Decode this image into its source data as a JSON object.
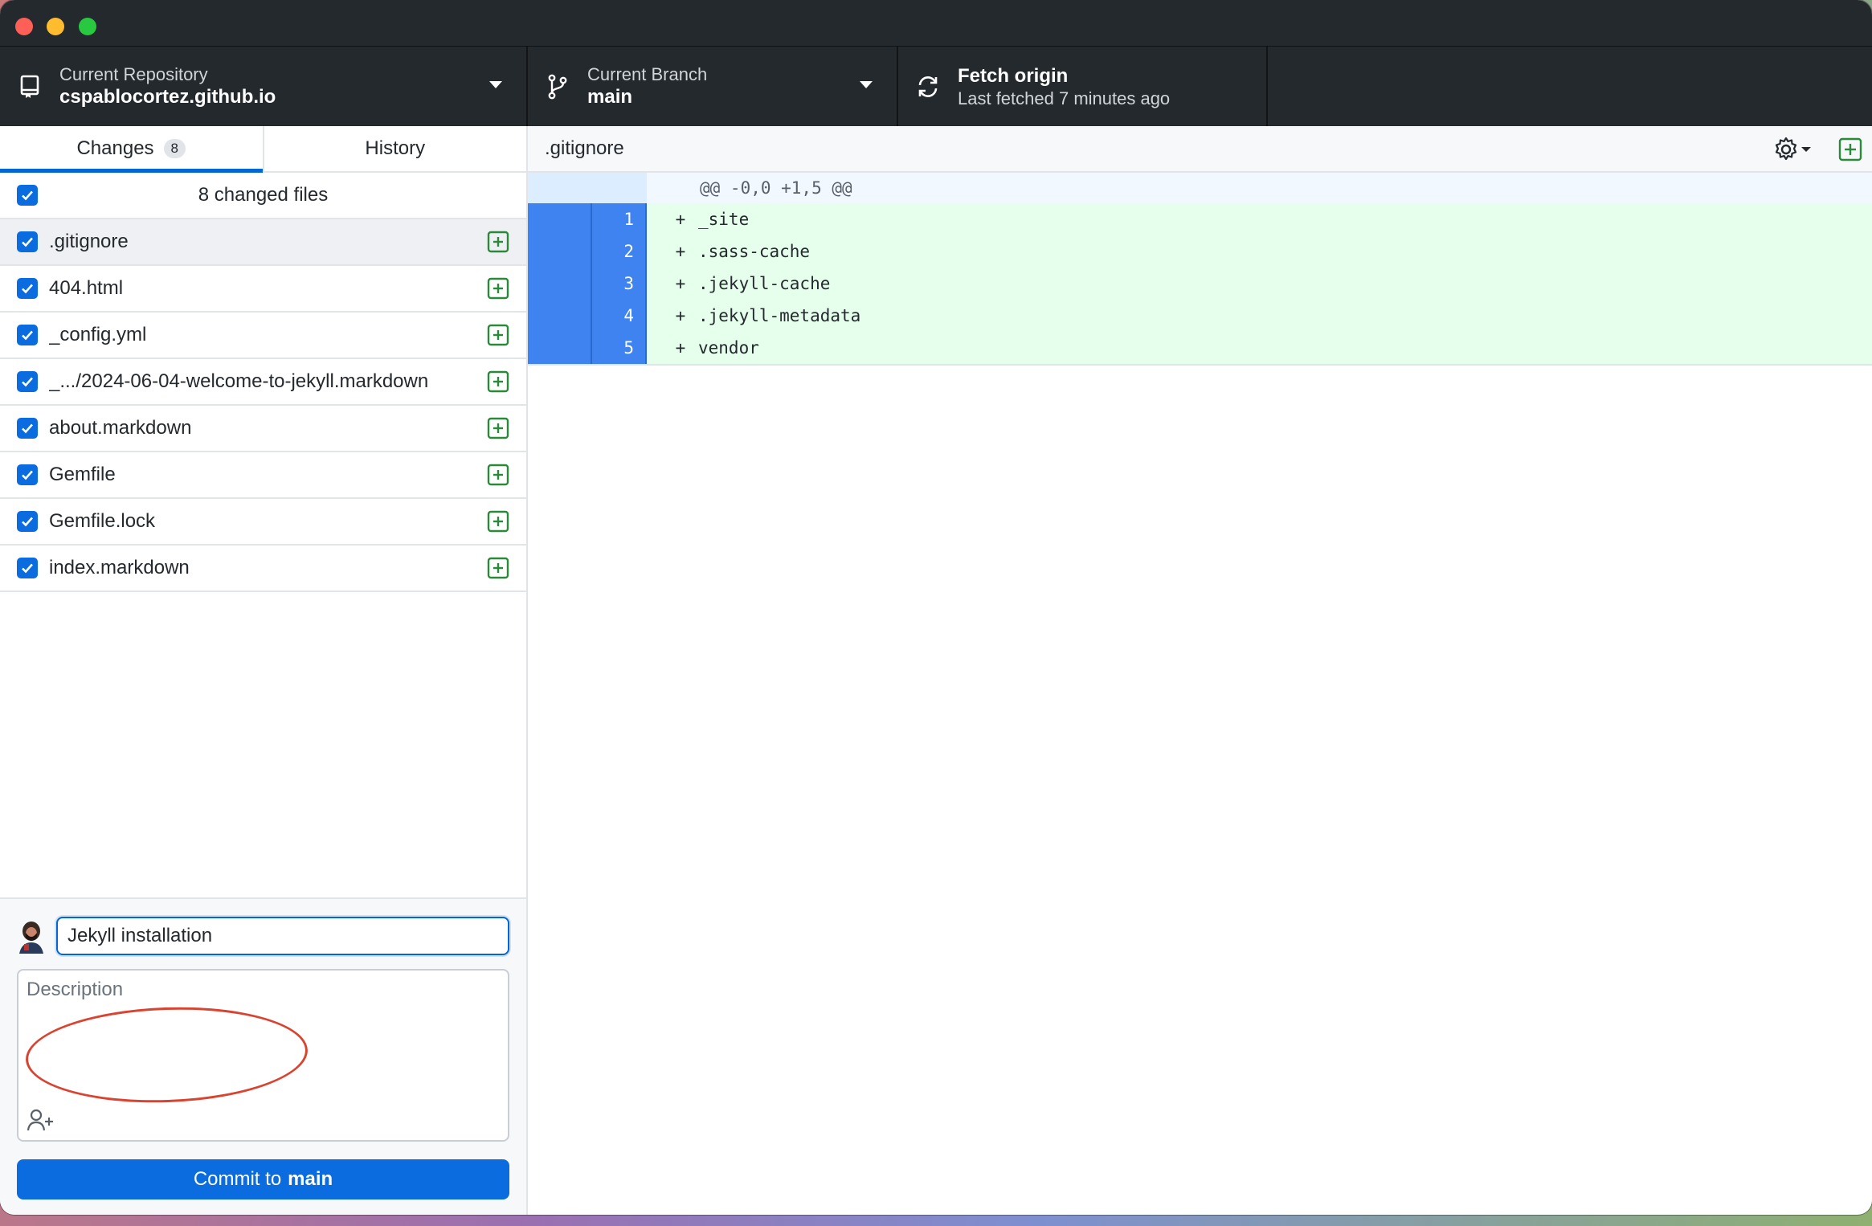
{
  "toolbar": {
    "repo": {
      "label": "Current Repository",
      "value": "cspablocortez.github.io"
    },
    "branch": {
      "label": "Current Branch",
      "value": "main"
    },
    "fetch": {
      "label": "Fetch origin",
      "value": "Last fetched 7 minutes ago"
    }
  },
  "tabs": [
    {
      "label": "Changes",
      "count": "8"
    },
    {
      "label": "History"
    }
  ],
  "files_header": "8 changed files",
  "files": [
    ".gitignore",
    "404.html",
    "_config.yml",
    "_.../2024-06-04-welcome-to-jekyll.markdown",
    "about.markdown",
    "Gemfile",
    "Gemfile.lock",
    "index.markdown"
  ],
  "commit": {
    "summary_value": "Jekyll installation",
    "description_placeholder": "Description",
    "button_prefix": "Commit to",
    "button_branch": "main"
  },
  "diff": {
    "path": ".gitignore",
    "hunk": "@@ -0,0 +1,5 @@",
    "lines": [
      {
        "num": "1",
        "sign": "+",
        "code": "_site"
      },
      {
        "num": "2",
        "sign": "+",
        "code": ".sass-cache"
      },
      {
        "num": "3",
        "sign": "+",
        "code": ".jekyll-cache"
      },
      {
        "num": "4",
        "sign": "+",
        "code": ".jekyll-metadata"
      },
      {
        "num": "5",
        "sign": "+",
        "code": "vendor"
      }
    ]
  },
  "colors": {
    "accent": "#0a6cde",
    "added_bg": "#e6ffec",
    "gutter_selected": "#3f83f0",
    "annotation": "#d9432f"
  }
}
